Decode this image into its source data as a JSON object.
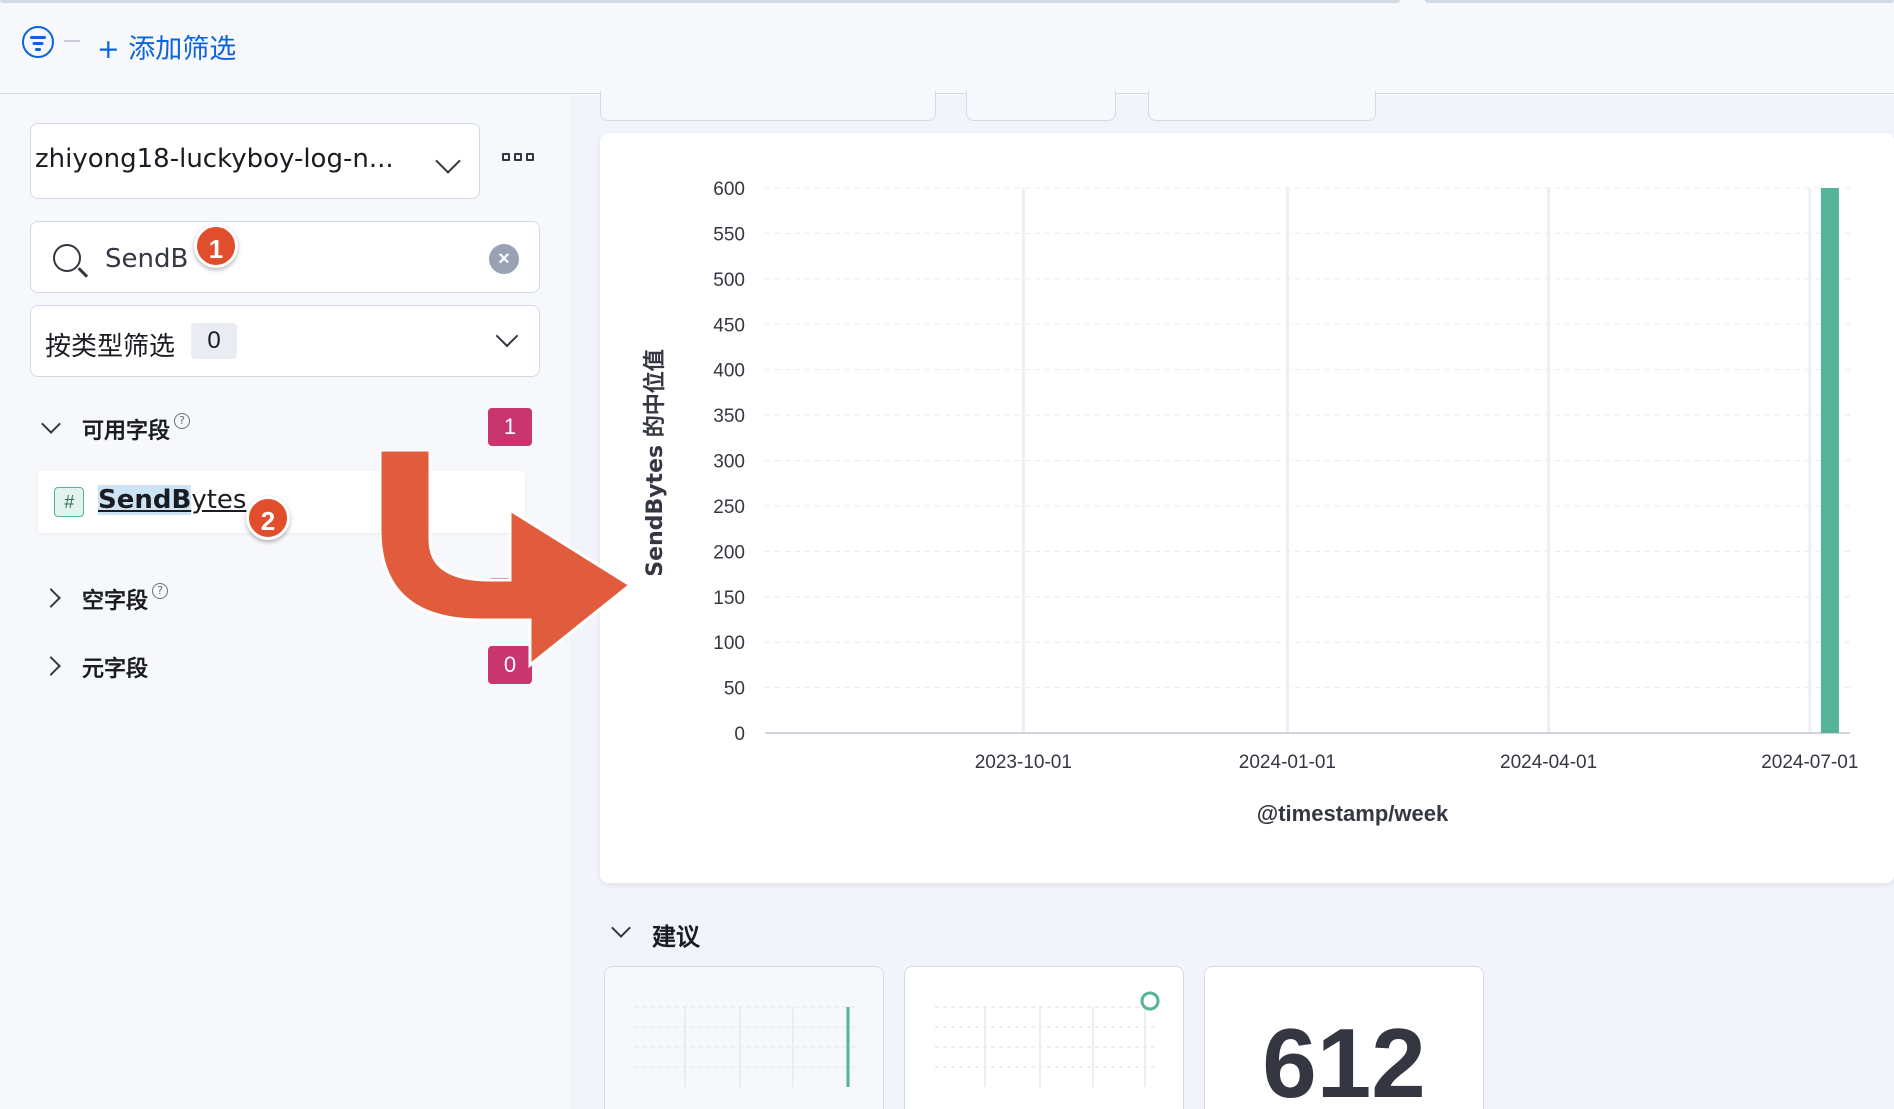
{
  "filter_bar": {
    "add_filter_label": "+ 添加筛选"
  },
  "sidebar": {
    "data_view_name": "zhiyong18-luckyboy-log-n...",
    "search": {
      "value": "SendB"
    },
    "type_filter": {
      "label": "按类型筛选",
      "count": "0"
    },
    "sections": [
      {
        "title": "可用字段",
        "count": "1",
        "expanded": true
      },
      {
        "title": "空字段",
        "count": "",
        "expanded": false
      },
      {
        "title": "元字段",
        "count": "0",
        "expanded": false
      }
    ],
    "fields": [
      {
        "type_icon": "#",
        "name_match": "SendB",
        "name_rest": "ytes"
      }
    ]
  },
  "markers": [
    "1",
    "2"
  ],
  "colors": {
    "bar": "#54b399",
    "badge": "#c9356e",
    "marker": "#e04e2b",
    "link": "#0b64dd"
  },
  "chart_data": {
    "type": "bar",
    "ylabel": "SendBytes 的中位值",
    "xlabel": "@timestamp/week",
    "ylim": [
      0,
      600
    ],
    "yticks": [
      0,
      50,
      100,
      150,
      200,
      250,
      300,
      350,
      400,
      450,
      500,
      550,
      600
    ],
    "xticks": [
      "2023-10-01",
      "2024-01-01",
      "2024-04-01",
      "2024-07-01"
    ],
    "x": [
      "2024-07-08"
    ],
    "values": [
      612
    ],
    "grid": true,
    "legend": "none"
  },
  "suggestions": {
    "title": "建议",
    "metric_value": "612"
  }
}
